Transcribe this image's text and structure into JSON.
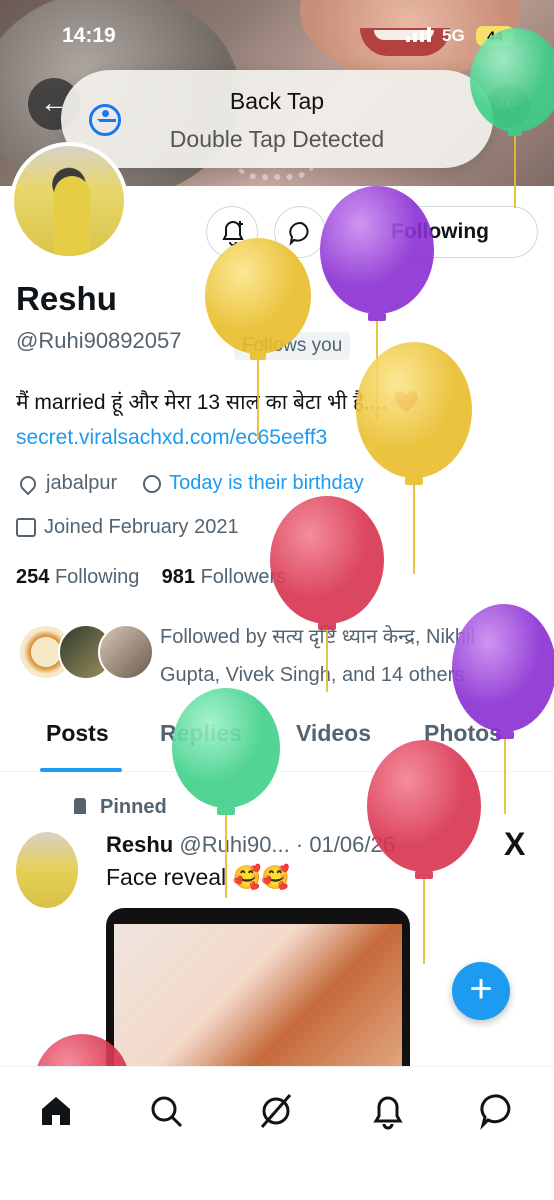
{
  "status_bar": {
    "time": "14:19",
    "network": "5G",
    "battery": "44"
  },
  "toast": {
    "title": "Back Tap",
    "subtitle": "Double Tap Detected"
  },
  "profile": {
    "name": "Reshu",
    "handle": "@Ruhi90892057",
    "follows_you": "Follows you",
    "bio": "मैं married हूं और मेरा 13 साल का बेटा भी है.... ❤️",
    "link": "secret.viralsachxd.com/ec65eeff3",
    "location": "jabalpur",
    "birthday": "Today is their birthday",
    "joined": "Joined February 2021",
    "following_count": "254",
    "following_label": "Following",
    "followers_count": "981",
    "followers_label": "Followers",
    "followed_by": "Followed by सत्य दृष्टि ध्यान केन्द्र, Nikhil Gupta, Vivek Singh, and 14 others",
    "follow_button": "Following"
  },
  "tabs": [
    "Posts",
    "Replies",
    "Videos",
    "Photos"
  ],
  "pinned_post": {
    "pinned_label": "Pinned",
    "author": "Reshu",
    "handle_date": "@Ruhi90... · 01/06/26",
    "text": "Face reveal 🥰🥰"
  },
  "bottom_nav": [
    "home-icon",
    "search-icon",
    "grok-icon",
    "notifications-icon",
    "messages-icon"
  ],
  "colors": {
    "accent": "#1d9bf0",
    "balloon_yellow": "#f2cd4a",
    "balloon_purple": "#a44fe0",
    "balloon_red": "#e24a62",
    "balloon_green": "#5fe0a3"
  }
}
